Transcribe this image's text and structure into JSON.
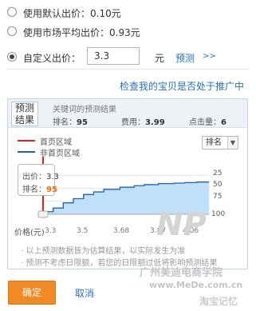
{
  "options": [
    {
      "label": "使用默认出价：0.10元",
      "checked": false
    },
    {
      "label": "使用市场平均出价：0.93元",
      "checked": false
    },
    {
      "label": "自定义出价：",
      "checked": true
    }
  ],
  "custom_price": {
    "value": "3.3",
    "unit": "元",
    "preview_label": "预测",
    "preview_arrow": ">>"
  },
  "check_link": "检查我的宝贝是否处于推广中",
  "forecast": {
    "tab_label_line1": "预测",
    "tab_label_line2": "结果",
    "caption": "关键词的预测结果",
    "stats": [
      {
        "label": "排名：",
        "value": "95"
      },
      {
        "label": "费用：",
        "value": "3.99"
      },
      {
        "label": "点击量：",
        "value": "6"
      }
    ],
    "legend": [
      {
        "label": "首页区域",
        "color": "#e02020"
      },
      {
        "label": "非首页区域",
        "color": "#2a5fb0"
      }
    ],
    "select_value": "排名",
    "select_arrow": "▼",
    "tooltip": {
      "price_label": "出价：",
      "price_value": "3.3",
      "rank_label": "排名：",
      "rank_value": "95"
    },
    "x_axis_label": "价格(元)",
    "notes": [
      "· 以上预测数据皆为估算结果，以实际发生为准",
      "· 预测不考虑日限额，若您的日限额过低将影响预测结果"
    ]
  },
  "chart_data": {
    "type": "area",
    "title": "",
    "xlabel": "价格(元)",
    "ylabel": "排名",
    "x_ticks": [
      "3.3",
      "3.5",
      "3.68",
      "3.87",
      "4.06"
    ],
    "y_ticks": [
      "25",
      "50",
      "75",
      "100"
    ],
    "ylim": [
      0,
      100
    ],
    "y_inverted": true,
    "series": [
      {
        "name": "非首页区域",
        "x": [
          3.3,
          3.35,
          3.4,
          3.45,
          3.5,
          3.55,
          3.6,
          3.68,
          3.75,
          3.8,
          3.87,
          3.95,
          4.0,
          4.06,
          4.12
        ],
        "y": [
          95,
          88,
          78,
          70,
          62,
          57,
          52,
          48,
          45,
          43,
          41,
          40,
          39,
          38,
          38
        ]
      }
    ],
    "marker_x": 3.3,
    "grid": true
  },
  "buttons": {
    "confirm": "确定",
    "cancel": "取消"
  },
  "watermark": {
    "site": "www.MeDe.com.cn",
    "school": "广州美迪电商学院",
    "tag": "淘宝记忆",
    "mark": "NP"
  },
  "colors": {
    "accent": "#f08a24",
    "link": "#2a6fbd",
    "series": "#2a5fb0",
    "area": "#bfe0f8",
    "first_page": "#e02020",
    "rank_highlight": "#ff6a00"
  }
}
